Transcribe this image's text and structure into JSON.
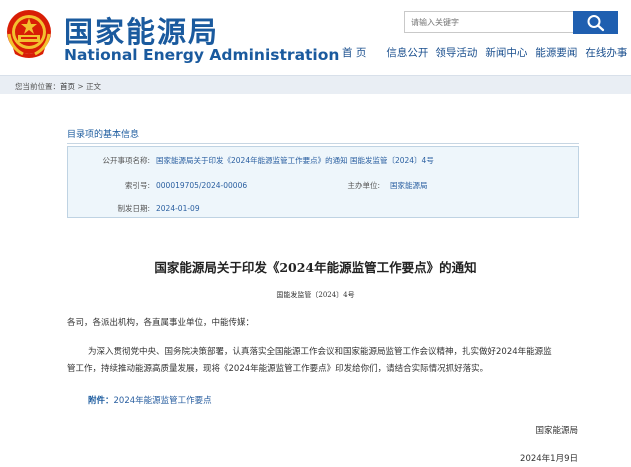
{
  "header": {
    "logo_cn": "国家能源局",
    "logo_en": "National Energy Administration",
    "search_placeholder": "请输入关键字",
    "nav": [
      "首 页",
      "信息公开",
      "领导活动",
      "新闻中心",
      "能源要闻",
      "在线办事"
    ]
  },
  "breadcrumb": {
    "prefix": "您当前位置：",
    "home": "首页",
    "sep": " > ",
    "current": "正文"
  },
  "info": {
    "title": "目录项的基本信息",
    "subject_label": "公开事项名称:",
    "subject_value": "国家能源局关于印发《2024年能源监管工作要点》的通知 国能发监管〔2024〕4号",
    "index_label": "索引号:",
    "index_value": "000019705/2024-00006",
    "owner_label": "主办单位:",
    "owner_value": "国家能源局",
    "date_label": "制发日期:",
    "date_value": "2024-01-09"
  },
  "article": {
    "title": "国家能源局关于印发《2024年能源监管工作要点》的通知",
    "doc_number": "国能发监管〔2024〕4号",
    "salutation": "各司，各派出机构，各直属事业单位，中能传媒：",
    "body_line1": "为深入贯彻党中央、国务院决策部署，认真落实全国能源工作会议和国家能源局监管工作会议精神，扎实做好2024年能源监",
    "body_line2": "管工作，持续推动能源高质量发展，现将《2024年能源监管工作要点》印发给你们，请结合实际情况抓好落实。",
    "attachment_label": "附件：",
    "attachment_link": "2024年能源监管工作要点",
    "signature": "国家能源局",
    "date": "2024年1月9日"
  },
  "colors": {
    "brand_blue": "#1a5a9e",
    "search_button": "#1f5fb0",
    "info_bg": "#eef6fb"
  }
}
